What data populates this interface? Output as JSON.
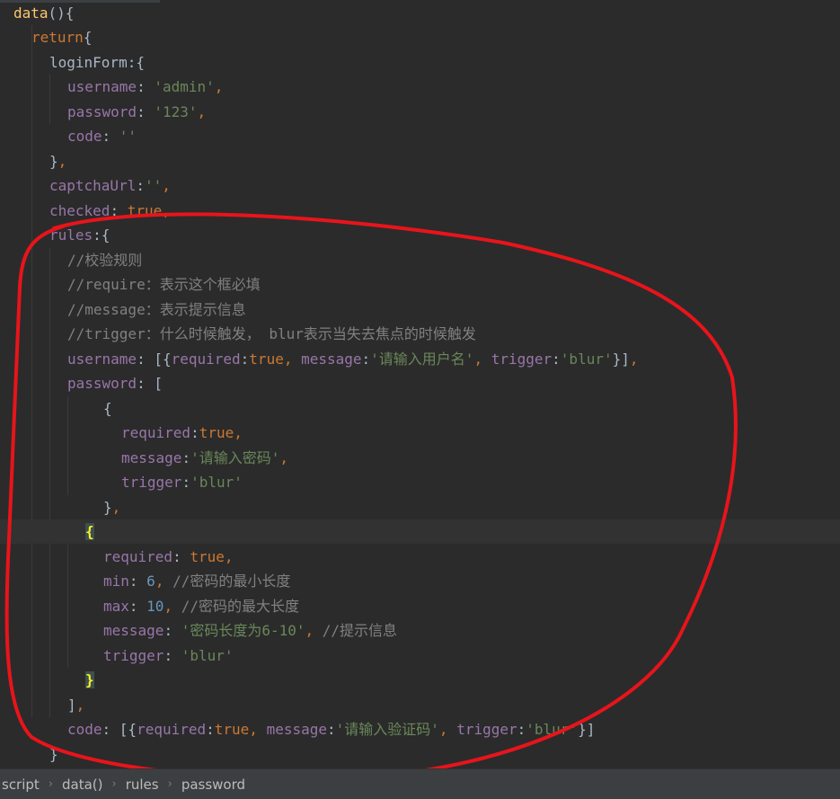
{
  "code_lines": [
    {
      "indent": 0,
      "tokens": [
        [
          "fn",
          "data"
        ],
        [
          "plain",
          "(){"
        ]
      ]
    },
    {
      "indent": 1,
      "tokens": [
        [
          "kw",
          "return"
        ],
        [
          "plain",
          "{"
        ]
      ]
    },
    {
      "indent": 2,
      "tokens": [
        [
          "plain",
          "loginForm:{"
        ]
      ]
    },
    {
      "indent": 3,
      "tokens": [
        [
          "prop",
          "username"
        ],
        [
          "plain",
          ": "
        ],
        [
          "str",
          "'admin'"
        ],
        [
          "kw",
          ","
        ]
      ]
    },
    {
      "indent": 3,
      "tokens": [
        [
          "prop",
          "password"
        ],
        [
          "plain",
          ": "
        ],
        [
          "str",
          "'123'"
        ],
        [
          "kw",
          ","
        ]
      ]
    },
    {
      "indent": 3,
      "tokens": [
        [
          "prop",
          "code"
        ],
        [
          "plain",
          ": "
        ],
        [
          "str",
          "''"
        ]
      ]
    },
    {
      "indent": 2,
      "tokens": [
        [
          "plain",
          "}"
        ],
        [
          "kw",
          ","
        ]
      ]
    },
    {
      "indent": 2,
      "tokens": [
        [
          "prop",
          "captchaUrl"
        ],
        [
          "plain",
          ":"
        ],
        [
          "str",
          "''"
        ],
        [
          "kw",
          ","
        ]
      ]
    },
    {
      "indent": 2,
      "tokens": [
        [
          "prop",
          "checked"
        ],
        [
          "plain",
          ": "
        ],
        [
          "kw",
          "true"
        ],
        [
          "kw",
          ","
        ]
      ]
    },
    {
      "indent": 2,
      "tokens": [
        [
          "prop",
          "rules"
        ],
        [
          "plain",
          ":{"
        ]
      ]
    },
    {
      "indent": 3,
      "tokens": [
        [
          "cmt",
          "//校验规则"
        ]
      ]
    },
    {
      "indent": 3,
      "tokens": [
        [
          "cmt",
          "//require：表示这个框必填"
        ]
      ]
    },
    {
      "indent": 3,
      "tokens": [
        [
          "cmt",
          "//message：表示提示信息"
        ]
      ]
    },
    {
      "indent": 3,
      "tokens": [
        [
          "cmt",
          "//trigger：什么时候触发， blur表示当失去焦点的时候触发"
        ]
      ]
    },
    {
      "indent": 3,
      "tokens": [
        [
          "prop",
          "username"
        ],
        [
          "plain",
          ": [{"
        ],
        [
          "prop",
          "required"
        ],
        [
          "plain",
          ":"
        ],
        [
          "kw",
          "true"
        ],
        [
          "kw",
          ", "
        ],
        [
          "prop",
          "message"
        ],
        [
          "plain",
          ":"
        ],
        [
          "str",
          "'请输入用户名'"
        ],
        [
          "kw",
          ", "
        ],
        [
          "prop",
          "trigger"
        ],
        [
          "plain",
          ":"
        ],
        [
          "str",
          "'blur'"
        ],
        [
          "plain",
          "}]"
        ],
        [
          "kw",
          ","
        ]
      ]
    },
    {
      "indent": 3,
      "tokens": [
        [
          "prop",
          "password"
        ],
        [
          "plain",
          ": ["
        ]
      ]
    },
    {
      "indent": 5,
      "tokens": [
        [
          "plain",
          "{"
        ]
      ]
    },
    {
      "indent": 6,
      "tokens": [
        [
          "prop",
          "required"
        ],
        [
          "plain",
          ":"
        ],
        [
          "kw",
          "true"
        ],
        [
          "kw",
          ","
        ]
      ]
    },
    {
      "indent": 6,
      "tokens": [
        [
          "prop",
          "message"
        ],
        [
          "plain",
          ":"
        ],
        [
          "str",
          "'请输入密码'"
        ],
        [
          "kw",
          ","
        ]
      ]
    },
    {
      "indent": 6,
      "tokens": [
        [
          "prop",
          "trigger"
        ],
        [
          "plain",
          ":"
        ],
        [
          "str",
          "'blur'"
        ]
      ]
    },
    {
      "indent": 5,
      "tokens": [
        [
          "plain",
          "}"
        ],
        [
          "kw",
          ","
        ]
      ]
    },
    {
      "indent": 4,
      "tokens": [
        [
          "hl",
          "{"
        ]
      ],
      "current": true
    },
    {
      "indent": 5,
      "tokens": [
        [
          "prop",
          "required"
        ],
        [
          "plain",
          ": "
        ],
        [
          "kw",
          "true"
        ],
        [
          "kw",
          ","
        ]
      ]
    },
    {
      "indent": 5,
      "tokens": [
        [
          "prop",
          "min"
        ],
        [
          "plain",
          ": "
        ],
        [
          "num",
          "6"
        ],
        [
          "kw",
          ", "
        ],
        [
          "cmt",
          "//密码的最小长度"
        ]
      ]
    },
    {
      "indent": 5,
      "tokens": [
        [
          "prop",
          "max"
        ],
        [
          "plain",
          ": "
        ],
        [
          "num",
          "10"
        ],
        [
          "kw",
          ", "
        ],
        [
          "cmt",
          "//密码的最大长度"
        ]
      ]
    },
    {
      "indent": 5,
      "tokens": [
        [
          "prop",
          "message"
        ],
        [
          "plain",
          ": "
        ],
        [
          "str",
          "'密码长度为6-10'"
        ],
        [
          "kw",
          ", "
        ],
        [
          "cmt",
          "//提示信息"
        ]
      ]
    },
    {
      "indent": 5,
      "tokens": [
        [
          "prop",
          "trigger"
        ],
        [
          "plain",
          ": "
        ],
        [
          "str",
          "'blur'"
        ]
      ]
    },
    {
      "indent": 4,
      "tokens": [
        [
          "hl",
          "}"
        ]
      ]
    },
    {
      "indent": 3,
      "tokens": [
        [
          "plain",
          "]"
        ],
        [
          "kw",
          ","
        ]
      ]
    },
    {
      "indent": 3,
      "tokens": [
        [
          "prop",
          "code"
        ],
        [
          "plain",
          ": [{"
        ],
        [
          "prop",
          "required"
        ],
        [
          "plain",
          ":"
        ],
        [
          "kw",
          "true"
        ],
        [
          "kw",
          ", "
        ],
        [
          "prop",
          "message"
        ],
        [
          "plain",
          ":"
        ],
        [
          "str",
          "'请输入验证码'"
        ],
        [
          "kw",
          ", "
        ],
        [
          "prop",
          "trigger"
        ],
        [
          "plain",
          ":"
        ],
        [
          "str",
          "'blur'"
        ],
        [
          "plain",
          "}]"
        ]
      ]
    },
    {
      "indent": 2,
      "tokens": [
        [
          "plain",
          "}"
        ]
      ]
    }
  ],
  "breadcrumb": {
    "items": [
      "script",
      "data()",
      "rules",
      "password"
    ],
    "separator_icon": "chevron-right-icon"
  },
  "annotation": {
    "shape": "hand-drawn-ellipse",
    "color": "#e8141b"
  },
  "theme": {
    "background": "#2b2b2b",
    "keyword": "#cc7832",
    "string": "#6a8759",
    "number": "#6897bb",
    "property": "#9876aa",
    "comment": "#808080",
    "function": "#ffc66d"
  }
}
